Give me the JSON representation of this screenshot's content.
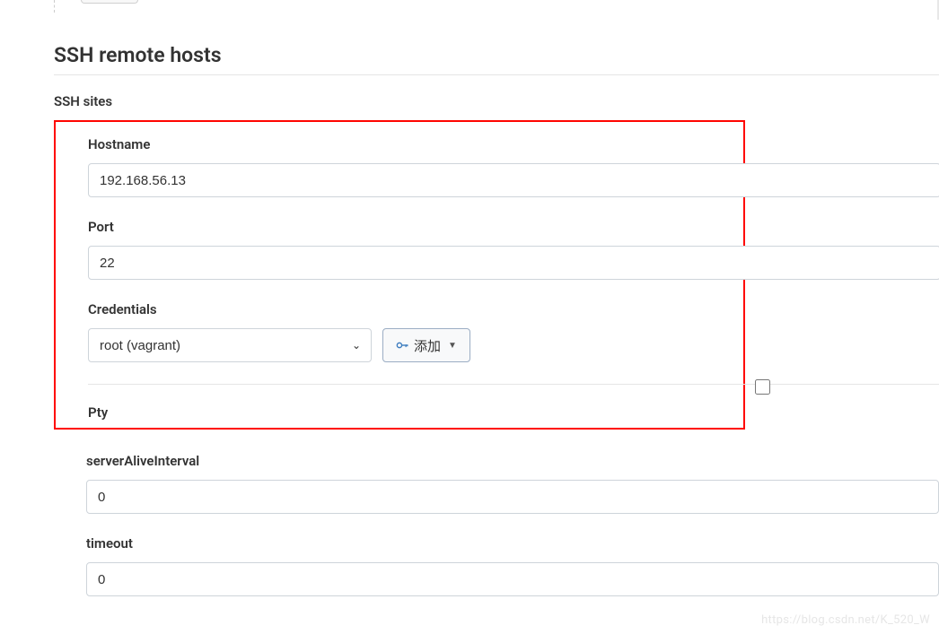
{
  "section": {
    "title": "SSH remote hosts",
    "subtitle": "SSH sites"
  },
  "fields": {
    "hostname": {
      "label": "Hostname",
      "value": "192.168.56.13"
    },
    "port": {
      "label": "Port",
      "value": "22"
    },
    "credentials": {
      "label": "Credentials",
      "selected": "root (vagrant)",
      "add_label": "添加"
    },
    "pty": {
      "label": "Pty"
    },
    "serverAliveInterval": {
      "label": "serverAliveInterval",
      "value": "0"
    },
    "timeout": {
      "label": "timeout",
      "value": "0"
    }
  },
  "watermark": "https://blog.csdn.net/K_520_W"
}
